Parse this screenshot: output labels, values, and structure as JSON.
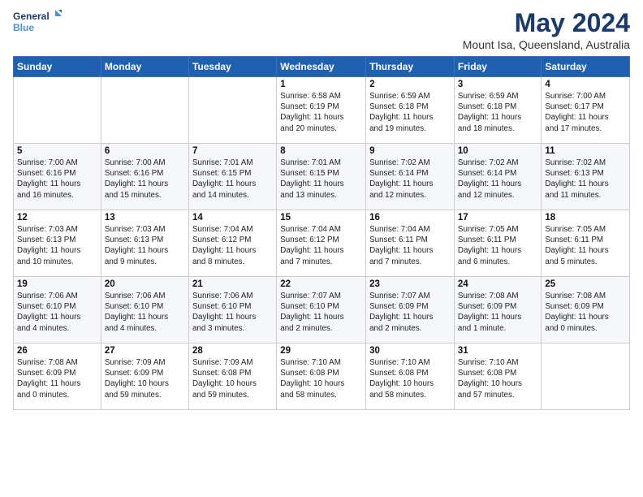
{
  "logo": {
    "line1": "General",
    "line2": "Blue"
  },
  "title": "May 2024",
  "subtitle": "Mount Isa, Queensland, Australia",
  "weekdays": [
    "Sunday",
    "Monday",
    "Tuesday",
    "Wednesday",
    "Thursday",
    "Friday",
    "Saturday"
  ],
  "weeks": [
    [
      {
        "day": "",
        "info": ""
      },
      {
        "day": "",
        "info": ""
      },
      {
        "day": "",
        "info": ""
      },
      {
        "day": "1",
        "info": "Sunrise: 6:58 AM\nSunset: 6:19 PM\nDaylight: 11 hours\nand 20 minutes."
      },
      {
        "day": "2",
        "info": "Sunrise: 6:59 AM\nSunset: 6:18 PM\nDaylight: 11 hours\nand 19 minutes."
      },
      {
        "day": "3",
        "info": "Sunrise: 6:59 AM\nSunset: 6:18 PM\nDaylight: 11 hours\nand 18 minutes."
      },
      {
        "day": "4",
        "info": "Sunrise: 7:00 AM\nSunset: 6:17 PM\nDaylight: 11 hours\nand 17 minutes."
      }
    ],
    [
      {
        "day": "5",
        "info": "Sunrise: 7:00 AM\nSunset: 6:16 PM\nDaylight: 11 hours\nand 16 minutes."
      },
      {
        "day": "6",
        "info": "Sunrise: 7:00 AM\nSunset: 6:16 PM\nDaylight: 11 hours\nand 15 minutes."
      },
      {
        "day": "7",
        "info": "Sunrise: 7:01 AM\nSunset: 6:15 PM\nDaylight: 11 hours\nand 14 minutes."
      },
      {
        "day": "8",
        "info": "Sunrise: 7:01 AM\nSunset: 6:15 PM\nDaylight: 11 hours\nand 13 minutes."
      },
      {
        "day": "9",
        "info": "Sunrise: 7:02 AM\nSunset: 6:14 PM\nDaylight: 11 hours\nand 12 minutes."
      },
      {
        "day": "10",
        "info": "Sunrise: 7:02 AM\nSunset: 6:14 PM\nDaylight: 11 hours\nand 12 minutes."
      },
      {
        "day": "11",
        "info": "Sunrise: 7:02 AM\nSunset: 6:13 PM\nDaylight: 11 hours\nand 11 minutes."
      }
    ],
    [
      {
        "day": "12",
        "info": "Sunrise: 7:03 AM\nSunset: 6:13 PM\nDaylight: 11 hours\nand 10 minutes."
      },
      {
        "day": "13",
        "info": "Sunrise: 7:03 AM\nSunset: 6:13 PM\nDaylight: 11 hours\nand 9 minutes."
      },
      {
        "day": "14",
        "info": "Sunrise: 7:04 AM\nSunset: 6:12 PM\nDaylight: 11 hours\nand 8 minutes."
      },
      {
        "day": "15",
        "info": "Sunrise: 7:04 AM\nSunset: 6:12 PM\nDaylight: 11 hours\nand 7 minutes."
      },
      {
        "day": "16",
        "info": "Sunrise: 7:04 AM\nSunset: 6:11 PM\nDaylight: 11 hours\nand 7 minutes."
      },
      {
        "day": "17",
        "info": "Sunrise: 7:05 AM\nSunset: 6:11 PM\nDaylight: 11 hours\nand 6 minutes."
      },
      {
        "day": "18",
        "info": "Sunrise: 7:05 AM\nSunset: 6:11 PM\nDaylight: 11 hours\nand 5 minutes."
      }
    ],
    [
      {
        "day": "19",
        "info": "Sunrise: 7:06 AM\nSunset: 6:10 PM\nDaylight: 11 hours\nand 4 minutes."
      },
      {
        "day": "20",
        "info": "Sunrise: 7:06 AM\nSunset: 6:10 PM\nDaylight: 11 hours\nand 4 minutes."
      },
      {
        "day": "21",
        "info": "Sunrise: 7:06 AM\nSunset: 6:10 PM\nDaylight: 11 hours\nand 3 minutes."
      },
      {
        "day": "22",
        "info": "Sunrise: 7:07 AM\nSunset: 6:10 PM\nDaylight: 11 hours\nand 2 minutes."
      },
      {
        "day": "23",
        "info": "Sunrise: 7:07 AM\nSunset: 6:09 PM\nDaylight: 11 hours\nand 2 minutes."
      },
      {
        "day": "24",
        "info": "Sunrise: 7:08 AM\nSunset: 6:09 PM\nDaylight: 11 hours\nand 1 minute."
      },
      {
        "day": "25",
        "info": "Sunrise: 7:08 AM\nSunset: 6:09 PM\nDaylight: 11 hours\nand 0 minutes."
      }
    ],
    [
      {
        "day": "26",
        "info": "Sunrise: 7:08 AM\nSunset: 6:09 PM\nDaylight: 11 hours\nand 0 minutes."
      },
      {
        "day": "27",
        "info": "Sunrise: 7:09 AM\nSunset: 6:09 PM\nDaylight: 10 hours\nand 59 minutes."
      },
      {
        "day": "28",
        "info": "Sunrise: 7:09 AM\nSunset: 6:08 PM\nDaylight: 10 hours\nand 59 minutes."
      },
      {
        "day": "29",
        "info": "Sunrise: 7:10 AM\nSunset: 6:08 PM\nDaylight: 10 hours\nand 58 minutes."
      },
      {
        "day": "30",
        "info": "Sunrise: 7:10 AM\nSunset: 6:08 PM\nDaylight: 10 hours\nand 58 minutes."
      },
      {
        "day": "31",
        "info": "Sunrise: 7:10 AM\nSunset: 6:08 PM\nDaylight: 10 hours\nand 57 minutes."
      },
      {
        "day": "",
        "info": ""
      }
    ]
  ]
}
